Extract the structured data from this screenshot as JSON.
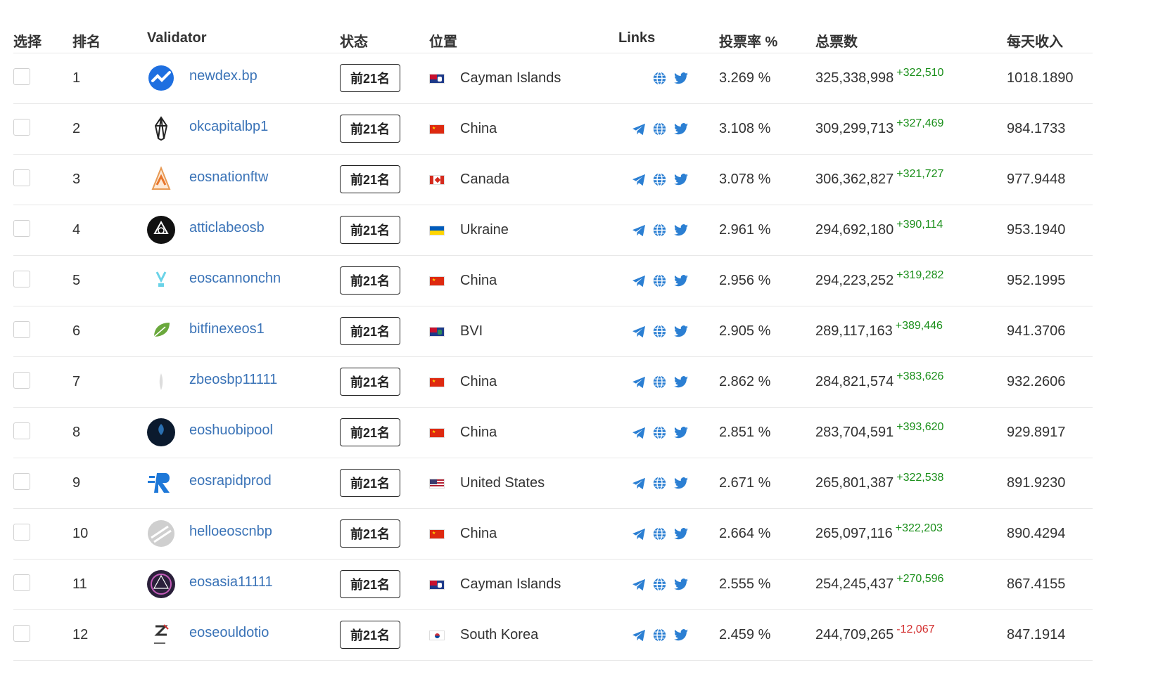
{
  "header": {
    "select": "选择",
    "rank": "排名",
    "validator": "Validator",
    "status": "状态",
    "location": "位置",
    "links": "Links",
    "vote_rate": "投票率 %",
    "total_votes": "总票数",
    "daily_income": "每天收入"
  },
  "colors": {
    "link_blue": "#3a73b7",
    "delta_positive": "#1a8f1a",
    "delta_negative": "#d32f2f",
    "icon_blue": "#2b7fd3"
  },
  "rows": [
    {
      "rank": "1",
      "name": "newdex.bp",
      "status": "前21名",
      "flag": "ky",
      "location": "Cayman Islands",
      "links": [
        "globe-icon",
        "twitter-icon"
      ],
      "rate": "3.269 %",
      "votes": "325,338,998",
      "delta": "+322,510",
      "daily": "1018.1890"
    },
    {
      "rank": "2",
      "name": "okcapitalbp1",
      "status": "前21名",
      "flag": "cn",
      "location": "China",
      "links": [
        "telegram-icon",
        "globe-icon",
        "twitter-icon"
      ],
      "rate": "3.108 %",
      "votes": "309,299,713",
      "delta": "+327,469",
      "daily": "984.1733"
    },
    {
      "rank": "3",
      "name": "eosnationftw",
      "status": "前21名",
      "flag": "ca",
      "location": "Canada",
      "links": [
        "telegram-icon",
        "globe-icon",
        "twitter-icon"
      ],
      "rate": "3.078 %",
      "votes": "306,362,827",
      "delta": "+321,727",
      "daily": "977.9448"
    },
    {
      "rank": "4",
      "name": "atticlabeosb",
      "status": "前21名",
      "flag": "ua",
      "location": "Ukraine",
      "links": [
        "telegram-icon",
        "globe-icon",
        "twitter-icon"
      ],
      "rate": "2.961 %",
      "votes": "294,692,180",
      "delta": "+390,114",
      "daily": "953.1940"
    },
    {
      "rank": "5",
      "name": "eoscannonchn",
      "status": "前21名",
      "flag": "cn",
      "location": "China",
      "links": [
        "telegram-icon",
        "globe-icon",
        "twitter-icon"
      ],
      "rate": "2.956 %",
      "votes": "294,223,252",
      "delta": "+319,282",
      "daily": "952.1995"
    },
    {
      "rank": "6",
      "name": "bitfinexeos1",
      "status": "前21名",
      "flag": "vg",
      "location": "BVI",
      "links": [
        "telegram-icon",
        "globe-icon",
        "twitter-icon"
      ],
      "rate": "2.905 %",
      "votes": "289,117,163",
      "delta": "+389,446",
      "daily": "941.3706"
    },
    {
      "rank": "7",
      "name": "zbeosbp11111",
      "status": "前21名",
      "flag": "cn",
      "location": "China",
      "links": [
        "telegram-icon",
        "globe-icon",
        "twitter-icon"
      ],
      "rate": "2.862 %",
      "votes": "284,821,574",
      "delta": "+383,626",
      "daily": "932.2606"
    },
    {
      "rank": "8",
      "name": "eoshuobipool",
      "status": "前21名",
      "flag": "cn",
      "location": "China",
      "links": [
        "telegram-icon",
        "globe-icon",
        "twitter-icon"
      ],
      "rate": "2.851 %",
      "votes": "283,704,591",
      "delta": "+393,620",
      "daily": "929.8917"
    },
    {
      "rank": "9",
      "name": "eosrapidprod",
      "status": "前21名",
      "flag": "us",
      "location": "United States",
      "links": [
        "telegram-icon",
        "globe-icon",
        "twitter-icon"
      ],
      "rate": "2.671 %",
      "votes": "265,801,387",
      "delta": "+322,538",
      "daily": "891.9230"
    },
    {
      "rank": "10",
      "name": "helloeoscnbp",
      "status": "前21名",
      "flag": "cn",
      "location": "China",
      "links": [
        "telegram-icon",
        "globe-icon",
        "twitter-icon"
      ],
      "rate": "2.664 %",
      "votes": "265,097,116",
      "delta": "+322,203",
      "daily": "890.4294"
    },
    {
      "rank": "11",
      "name": "eosasia11111",
      "status": "前21名",
      "flag": "ky",
      "location": "Cayman Islands",
      "links": [
        "telegram-icon",
        "globe-icon",
        "twitter-icon"
      ],
      "rate": "2.555 %",
      "votes": "254,245,437",
      "delta": "+270,596",
      "daily": "867.4155"
    },
    {
      "rank": "12",
      "name": "eoseouldotio",
      "status": "前21名",
      "flag": "kr",
      "location": "South Korea",
      "links": [
        "telegram-icon",
        "globe-icon",
        "twitter-icon"
      ],
      "rate": "2.459 %",
      "votes": "244,709,265",
      "delta": "-12,067",
      "daily": "847.1914"
    }
  ]
}
